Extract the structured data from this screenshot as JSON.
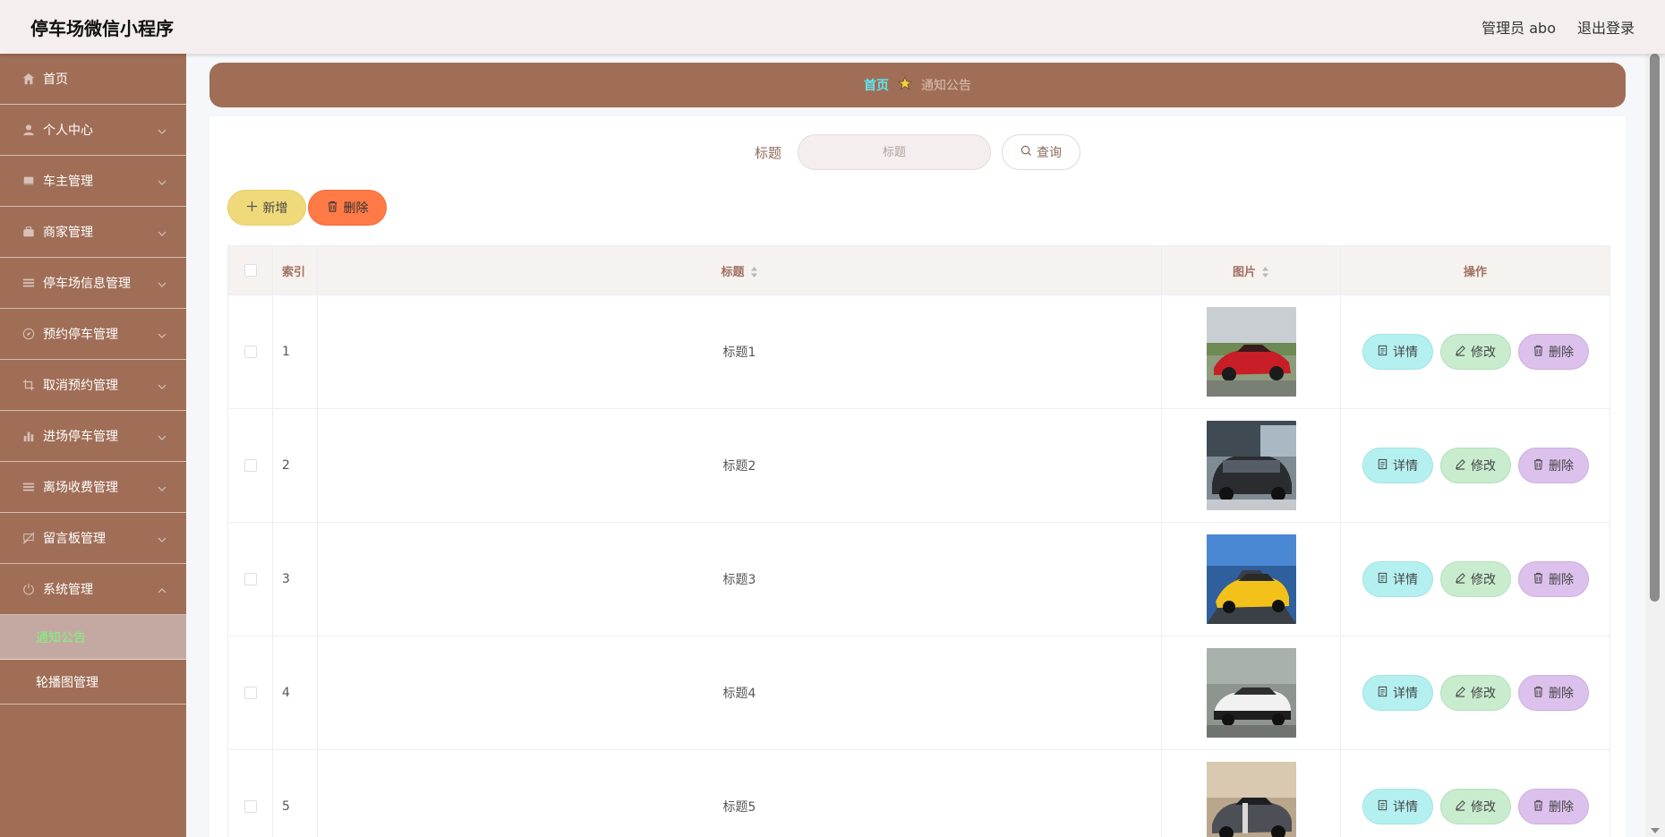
{
  "header": {
    "app_title": "停车场微信小程序",
    "user_label": "管理员 abo",
    "logout_label": "退出登录"
  },
  "sidebar": {
    "items": [
      {
        "label": "首页",
        "icon": "home-icon"
      },
      {
        "label": "个人中心",
        "icon": "user-icon"
      },
      {
        "label": "车主管理",
        "icon": "car-owner-icon"
      },
      {
        "label": "商家管理",
        "icon": "merchant-icon"
      },
      {
        "label": "停车场信息管理",
        "icon": "list-icon"
      },
      {
        "label": "预约停车管理",
        "icon": "compass-icon"
      },
      {
        "label": "取消预约管理",
        "icon": "crop-icon"
      },
      {
        "label": "进场停车管理",
        "icon": "bar-chart-icon"
      },
      {
        "label": "离场收费管理",
        "icon": "list-icon"
      },
      {
        "label": "留言板管理",
        "icon": "message-off-icon"
      },
      {
        "label": "系统管理",
        "icon": "power-icon"
      }
    ],
    "sub_items": [
      {
        "label": "通知公告",
        "active": true
      },
      {
        "label": "轮播图管理",
        "active": false
      }
    ]
  },
  "breadcrumb": {
    "home": "首页",
    "current": "通知公告"
  },
  "search": {
    "label": "标题",
    "placeholder": "标题",
    "query_label": "查询"
  },
  "actions": {
    "add_label": "新增",
    "delete_label": "删除"
  },
  "table": {
    "headers": {
      "index": "索引",
      "title": "标题",
      "image": "图片",
      "ops": "操作"
    },
    "op_labels": {
      "detail": "详情",
      "edit": "修改",
      "delete": "删除"
    },
    "rows": [
      {
        "index": "1",
        "title": "标题1",
        "image": "red-sports-car"
      },
      {
        "index": "2",
        "title": "标题2",
        "image": "dark-sedan"
      },
      {
        "index": "3",
        "title": "标题3",
        "image": "yellow-sports-car"
      },
      {
        "index": "4",
        "title": "标题4",
        "image": "white-coupe"
      },
      {
        "index": "5",
        "title": "标题5",
        "image": "grey-muscle-car"
      }
    ]
  },
  "colors": {
    "sidebar": "#a06e56",
    "header": "#f5eeee",
    "active_sub_text": "#7cf67c",
    "breadcrumb_home": "#5ee6f0"
  }
}
